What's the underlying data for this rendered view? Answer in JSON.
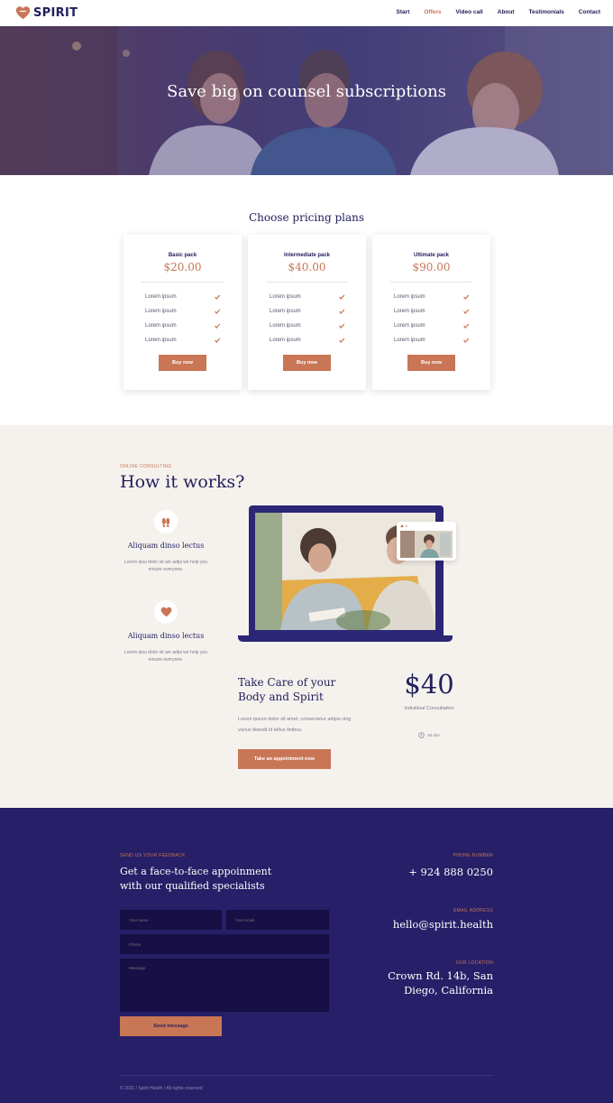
{
  "header": {
    "logo_text": "SPIRIT",
    "nav": [
      {
        "label": "Start",
        "active": false
      },
      {
        "label": "Offers",
        "active": true
      },
      {
        "label": "Video call",
        "active": false
      },
      {
        "label": "About",
        "active": false
      },
      {
        "label": "Testimonials",
        "active": false
      },
      {
        "label": "Contact",
        "active": false
      }
    ]
  },
  "hero": {
    "title": "Save big on counsel subscriptions"
  },
  "pricing": {
    "title": "Choose pricing plans",
    "plans": [
      {
        "name": "Basic pack",
        "price": "$20.00",
        "items": [
          "Lorem ipsum",
          "Lorem ipsum",
          "Lorem ipsum",
          "Lorem ipsum"
        ],
        "button": "Buy now"
      },
      {
        "name": "Intermediate pack",
        "price": "$40.00",
        "items": [
          "Lorem ipsum",
          "Lorem ipsum",
          "Lorem ipsum",
          "Lorem ipsum"
        ],
        "button": "Buy now"
      },
      {
        "name": "Ultimate pack",
        "price": "$90.00",
        "items": [
          "Lorem ipsum",
          "Lorem ipsum",
          "Lorem ipsum",
          "Lorem ipsum"
        ],
        "button": "Buy now"
      }
    ]
  },
  "how": {
    "eyebrow": "ONLINE CONSULTING",
    "title": "How it works?",
    "features": [
      {
        "icon": "feet-icon",
        "title": "Aliquam dinso lectus",
        "desc": "Lorem ipsu dolor sit am adipi we help you ensure everyone."
      },
      {
        "icon": "heart-icon",
        "title": "Aliquam dinso lectus",
        "desc": "Lorem ipsu dolor sit am adipi we help you ensure everyone."
      }
    ],
    "care_title": "Take Care of your Body and Spirit",
    "care_desc": "Lorem ipsum dolor sit amet, consectetur adipis cing varius blandit id tellus finibus.",
    "care_button": "Take an appointment now",
    "price": "$40",
    "consult": "Individual Consultation",
    "duration": "50 min"
  },
  "contact": {
    "eyebrow": "SEND US YOUR FEEDBACK",
    "lead": "Get a face-to-face appoinment with our qualified specialists",
    "form": {
      "name_placeholder": "Your name",
      "email_placeholder": "Your email",
      "phone_placeholder": "Phone",
      "message_placeholder": "Message",
      "send_label": "Send message"
    },
    "phone_label": "PHONE NUMBER",
    "phone": "+ 924 888 0250",
    "email_label": "EMAIL ADDRESS",
    "email": "hello@spirit.health",
    "location_label": "OUR LOCATION",
    "location": "Crown Rd. 14b, San Diego, California",
    "copyright": "© 2021 / Spirit Health / All rights reserved"
  },
  "colors": {
    "accent": "#c97656",
    "navy": "#22205c",
    "footer": "#271f67",
    "cream": "#f5f2ee"
  }
}
